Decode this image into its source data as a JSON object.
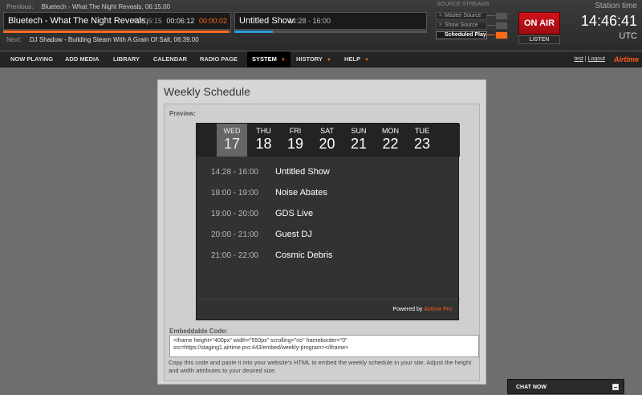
{
  "player": {
    "previous_label": "Previous:",
    "previous_value": "Bluetech - What The Night Reveals, 06:15.00",
    "next_label": "Next:",
    "next_value": "DJ Shadow - Building Steam With A Grain Of Salt, 06:39.00",
    "now_playing_track": "Bluetech - What The Night Reveals,",
    "track_length": "00:06:15",
    "elapsed": "00:06:12",
    "remaining": "00:00:02",
    "track_progress": 0.99,
    "show_name": "Untitled Show",
    "show_time": "14:28 - 16:00",
    "show_progress": 0.2
  },
  "source_streams": {
    "title": "SOURCE STREAMS",
    "sources": [
      {
        "label": "Master Source",
        "active": false
      },
      {
        "label": "Show Source",
        "active": false
      },
      {
        "label": "Scheduled Play",
        "active": true
      }
    ]
  },
  "on_air": {
    "label": "ON AIR",
    "listen_label": "LISTEN"
  },
  "station_time": {
    "label": "Station time",
    "time": "14:46:41",
    "timezone": "UTC"
  },
  "nav": {
    "items": [
      {
        "label": "NOW PLAYING",
        "dropdown": false,
        "active": false
      },
      {
        "label": "ADD MEDIA",
        "dropdown": false,
        "active": false
      },
      {
        "label": "LIBRARY",
        "dropdown": false,
        "active": false
      },
      {
        "label": "CALENDAR",
        "dropdown": false,
        "active": false
      },
      {
        "label": "RADIO PAGE",
        "dropdown": false,
        "active": false
      },
      {
        "label": "SYSTEM",
        "dropdown": true,
        "active": true
      },
      {
        "label": "HISTORY",
        "dropdown": true,
        "active": false
      },
      {
        "label": "HELP",
        "dropdown": true,
        "active": false
      }
    ],
    "user": "test",
    "separator": "|",
    "logout": "Logout",
    "brand": "Airtime"
  },
  "page": {
    "title": "Weekly Schedule",
    "preview_label": "Preview:",
    "embed_label": "Embeddable Code:",
    "embed_code": "<iframe height=\"400px\" width=\"550px\" scrolling=\"no\" frameborder=\"0\" src=https://staging1.airtime.pro:443/embed/weekly-program></iframe>",
    "help_text": "Copy this code and paste it into your website's HTML to embed the weekly schedule in your site. Adjust the height and width attributes to your desired size."
  },
  "widget": {
    "days": [
      {
        "name": "WED",
        "num": "17",
        "active": true
      },
      {
        "name": "THU",
        "num": "18",
        "active": false
      },
      {
        "name": "FRI",
        "num": "19",
        "active": false
      },
      {
        "name": "SAT",
        "num": "20",
        "active": false
      },
      {
        "name": "SUN",
        "num": "21",
        "active": false
      },
      {
        "name": "MON",
        "num": "22",
        "active": false
      },
      {
        "name": "TUE",
        "num": "23",
        "active": false
      }
    ],
    "events": [
      {
        "time": "14:28 - 16:00",
        "title": "Untitled Show"
      },
      {
        "time": "18:00 - 19:00",
        "title": "Noise Abates"
      },
      {
        "time": "19:00 - 20:00",
        "title": "GDS Live"
      },
      {
        "time": "20:00 - 21:00",
        "title": "Guest DJ"
      },
      {
        "time": "21:00 - 22:00",
        "title": "Cosmic Debris"
      }
    ],
    "powered_by": "Powered by",
    "powered_brand": "Airtime Pro"
  },
  "chat": {
    "label": "CHAT NOW"
  },
  "colors": {
    "accent": "#ff6a1a",
    "on_air": "#c4111a",
    "show_progress": "#2aa0dc"
  }
}
